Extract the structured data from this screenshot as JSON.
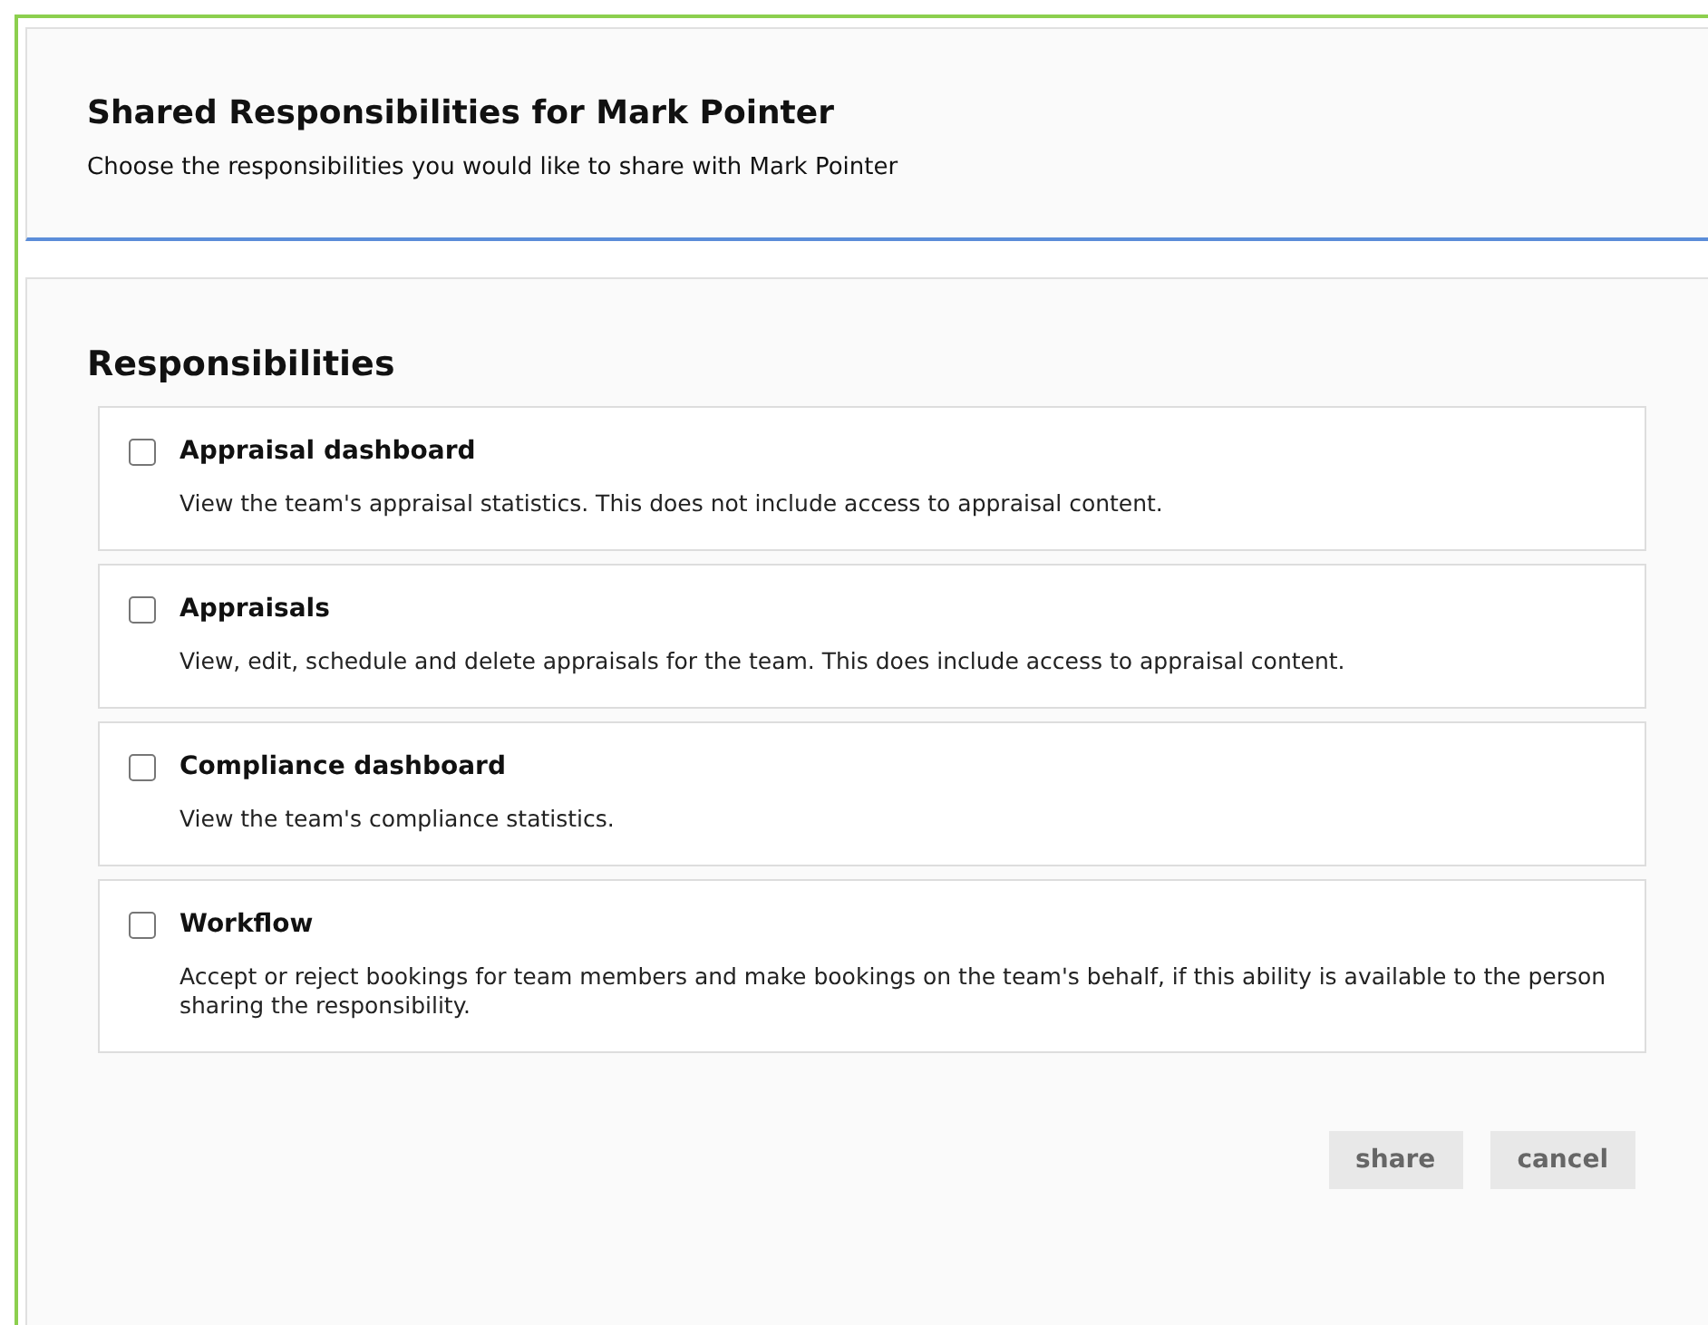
{
  "header": {
    "title": "Shared Responsibilities for Mark Pointer",
    "subtitle": "Choose the responsibilities you would like to share with Mark Pointer"
  },
  "section_title": "Responsibilities",
  "responsibilities": [
    {
      "name": "Appraisal dashboard",
      "description": "View the team's appraisal statistics. This does not include access to appraisal content.",
      "checked": false
    },
    {
      "name": "Appraisals",
      "description": "View, edit, schedule and delete appraisals for the team. This does include access to appraisal content.",
      "checked": false
    },
    {
      "name": "Compliance dashboard",
      "description": "View the team's compliance statistics.",
      "checked": false
    },
    {
      "name": "Workflow",
      "description": "Accept or reject bookings for team members and make bookings on the team's behalf, if this ability is available to the person sharing the responsibility.",
      "checked": false
    }
  ],
  "buttons": [
    "share",
    "cancel"
  ]
}
